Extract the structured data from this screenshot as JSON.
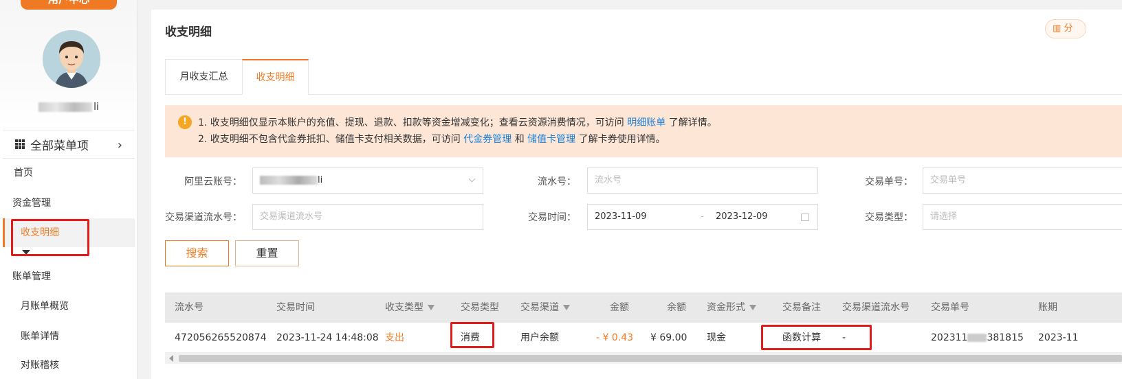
{
  "sidebar": {
    "banner_label": "用户中心",
    "username_suffix": "li",
    "all_menu_label": "全部菜单项",
    "items": [
      {
        "label": "首页"
      },
      {
        "label": "资金管理"
      },
      {
        "label": "收支明细"
      },
      {
        "label": "账单管理"
      },
      {
        "label": "月账单概览"
      },
      {
        "label": "账单详情"
      },
      {
        "label": "对账稽核"
      }
    ]
  },
  "header": {
    "title": "收支明细",
    "top_right_label": "分"
  },
  "tabs": [
    {
      "label": "月收支汇总",
      "active": false
    },
    {
      "label": "收支明细",
      "active": true
    }
  ],
  "notice": {
    "icon": "!",
    "line1_text": "1. 收支明细仅显示本账户的充值、提现、退款、扣款等资金增减变化；查看云资源消费情况，可访问",
    "line1_link": "明细账单",
    "line1_tail": "了解详情。",
    "line2_text": "2. 收支明细不包含代金券抵扣、储值卡支付相关数据，可访问",
    "line2_link1": "代金券管理",
    "line2_mid": "和",
    "line2_link2": "储值卡管理",
    "line2_tail": "了解卡券使用详情。"
  },
  "filters": {
    "account_label": "阿里云账号：",
    "account_value_suffix": "li",
    "serial_label": "流水号：",
    "serial_placeholder": "流水号",
    "order_label": "交易单号：",
    "order_placeholder": "交易单号",
    "channel_serial_label": "交易渠道流水号：",
    "channel_serial_placeholder": "交易渠道流水号",
    "time_label": "交易时间：",
    "date_start": "2023-11-09",
    "date_sep": "-",
    "date_end": "2023-12-09",
    "type_label": "交易类型：",
    "type_placeholder": "请选择",
    "search_label": "搜索",
    "reset_label": "重置"
  },
  "table": {
    "columns": [
      "流水号",
      "交易时间",
      "收支类型",
      "交易类型",
      "交易渠道",
      "金额",
      "余额",
      "资金形式",
      "交易备注",
      "交易渠道流水号",
      "交易单号",
      "账期"
    ],
    "rows": [
      {
        "serial": "472056265520874",
        "time": "2023-11-24 14:48:08",
        "flow_type": "支出",
        "trade_type": "消费",
        "channel": "用户余额",
        "amount": "- ¥ 0.43",
        "balance": "¥ 69.00",
        "fund_form": "现金",
        "remark": "函数计算",
        "channel_serial": "-",
        "order_no_prefix": "202311",
        "order_no_suffix": "381815",
        "period": "2023-11"
      }
    ]
  },
  "colors": {
    "accent": "#f07a23",
    "highlight_box": "#e21b1b",
    "link": "#1a7fd9",
    "notice_bg": "#fde6d6"
  }
}
